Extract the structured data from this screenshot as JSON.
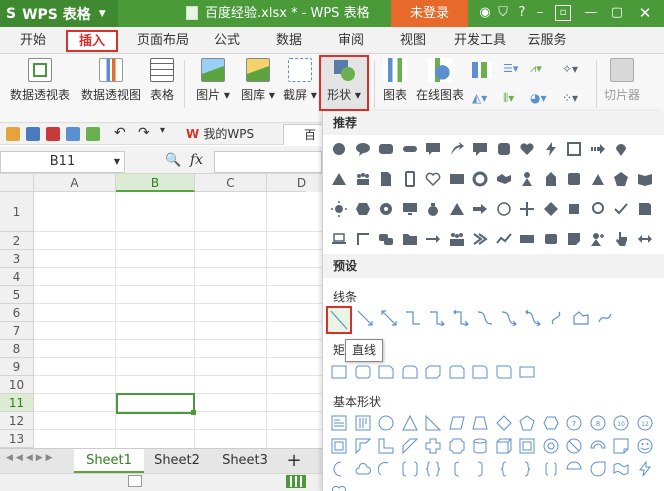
{
  "titlebar": {
    "app_name": "WPS 表格",
    "doc_title": "百度经验.xlsx * - WPS 表格",
    "login_label": "未登录",
    "icons": [
      "shirt-icon",
      "tshirt-icon",
      "help-icon",
      "minimize-icon",
      "restore-icon",
      "close-icon"
    ]
  },
  "menu": [
    "开始",
    "插入",
    "页面布局",
    "公式",
    "数据",
    "审阅",
    "视图",
    "开发工具",
    "云服务"
  ],
  "ribbon": {
    "pivot_table": "数据透视表",
    "pivot_chart": "数据透视图",
    "table": "表格",
    "picture": "图片",
    "gallery": "图库",
    "screenshot": "截屏",
    "shape": "形状",
    "chart": "图表",
    "online_chart": "在线图表",
    "slicer": "切片器"
  },
  "quickbar": {
    "mywps": "我的WPS",
    "workbook_tab": "百度"
  },
  "formula": {
    "cell_ref": "B11",
    "fx": "fx"
  },
  "grid": {
    "columns": [
      "A",
      "B",
      "C",
      "D"
    ],
    "rows": [
      "1",
      "2",
      "3",
      "4",
      "5",
      "6",
      "7",
      "8",
      "9",
      "10",
      "11",
      "12",
      "13"
    ]
  },
  "sheets": [
    "Sheet1",
    "Sheet2",
    "Sheet3",
    "+"
  ],
  "panel": {
    "recommended": "推荐",
    "preset": "预设",
    "lines": "线条",
    "rect": "矩",
    "basic": "基本形状",
    "tooltip": "直线"
  },
  "colors": {
    "brand_green": "#4a9a3a",
    "login_orange": "#e86a2a",
    "highlight_red": "#d9302c",
    "icon_gray": "#5a6470"
  }
}
